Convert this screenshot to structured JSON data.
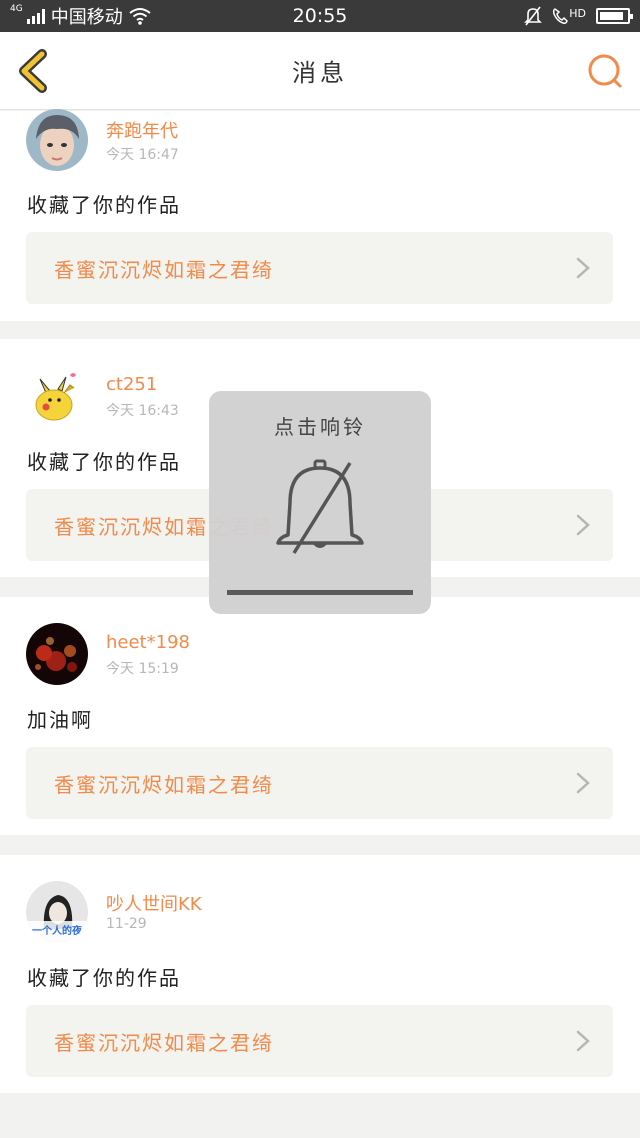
{
  "status_bar": {
    "network_type": "4G",
    "carrier": "中国移动",
    "time": "20:55",
    "hd_label": "HD",
    "battery_level": 0.9,
    "icons": [
      "signal-icon",
      "wifi-icon",
      "mute-icon",
      "call-hd-icon",
      "battery-icon"
    ]
  },
  "header": {
    "title": "消息",
    "back_icon": "chevron-left-icon",
    "search_icon": "search-icon"
  },
  "notifications": [
    {
      "user": "奔跑年代",
      "time": "今天 16:47",
      "message": "收藏了你的作品",
      "work_title": "香蜜沉沉烬如霜之君绮"
    },
    {
      "user": "ct251",
      "time": "今天 16:43",
      "message": "收藏了你的作品",
      "work_title": "香蜜沉沉烬如霜之君绮"
    },
    {
      "user": "heet*198",
      "time": "今天 15:19",
      "message": "加油啊",
      "work_title": "香蜜沉沉烬如霜之君绮"
    },
    {
      "user": "吵人世间KK",
      "time": "11-29",
      "message": "收藏了你的作品",
      "work_title": "香蜜沉沉烬如霜之君绮",
      "avatar_text": "一个人的夜"
    }
  ],
  "ring_toast": {
    "label": "点击响铃",
    "icon": "bell-muted-icon"
  },
  "colors": {
    "accent": "#f28a4a",
    "back_arrow": "#f0c330",
    "status_bar": "#3a3a3a"
  }
}
